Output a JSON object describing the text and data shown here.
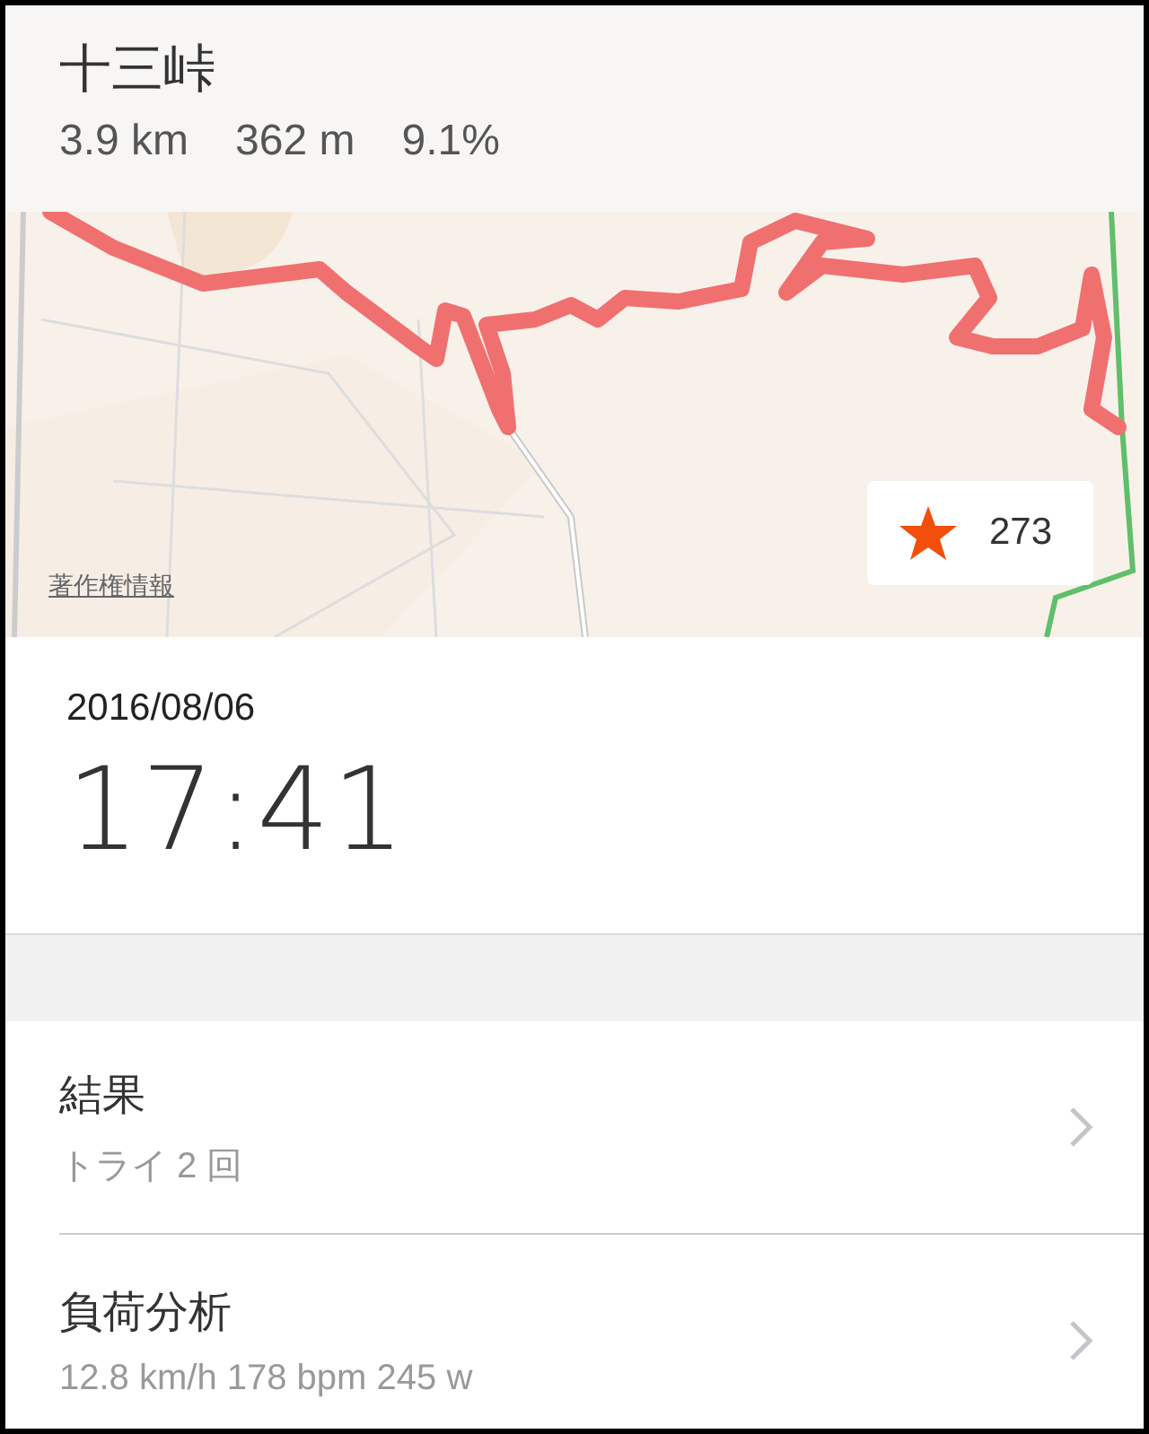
{
  "segment": {
    "title": "十三峠",
    "stats": [
      "3.9 km",
      "362 m",
      "9.1%"
    ]
  },
  "map": {
    "kind": "picture",
    "copyright_link": "著作権情報",
    "rank_badge": {
      "value": "273"
    }
  },
  "effort": {
    "date": "2016/08/06",
    "time": "17:41"
  },
  "rows": [
    {
      "title": "結果",
      "subtitle": "トライ 2 回"
    },
    {
      "title": "負荷分析",
      "subtitle": "12.8 km/h 178 bpm 245 w"
    }
  ]
}
